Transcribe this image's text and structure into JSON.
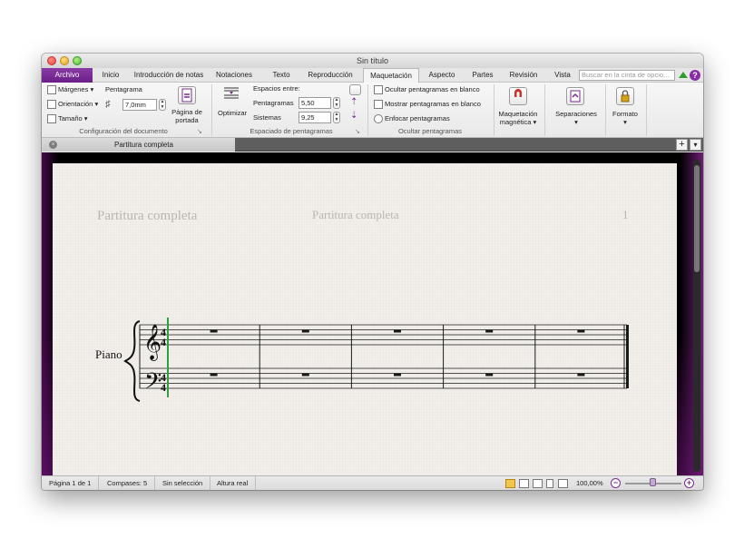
{
  "window": {
    "title": "Sin título"
  },
  "ribbon_tabs": [
    "Archivo",
    "Inicio",
    "Introducción de notas",
    "Notaciones",
    "Texto",
    "Reproducción",
    "Maquetación",
    "Aspecto",
    "Partes",
    "Revisión",
    "Vista"
  ],
  "active_tab": "Maquetación",
  "search": {
    "placeholder": "Buscar en la cinta de opcio..."
  },
  "help": {
    "label": "?"
  },
  "doc_config": {
    "margins": "Márgenes",
    "orientation": "Orientación",
    "size": "Tamaño",
    "staff_label": "Pentagrama",
    "staff_value": "7,0mm",
    "cover_page_line1": "Página de",
    "cover_page_line2": "portada",
    "group_label": "Configuración del documento"
  },
  "staff_spacing": {
    "optimize": "Optimizar",
    "spaces_between": "Espacios entre:",
    "staves_label": "Pentagramas",
    "staves_value": "5,50",
    "systems_label": "Sistemas",
    "systems_value": "9,25",
    "group_label": "Espaciado de pentagramas"
  },
  "hide_staves": {
    "hide_empty": "Ocultar pentagramas en blanco",
    "show_empty": "Mostrar pentagramas en blanco",
    "focus": "Enfocar pentagramas",
    "group_label": "Ocultar pentagramas"
  },
  "magnetic": {
    "line1": "Maquetación",
    "line2": "magnética"
  },
  "breaks": {
    "label": "Separaciones"
  },
  "format": {
    "label": "Formato"
  },
  "document_tab": {
    "title": "Partitura completa",
    "close_glyph": "×"
  },
  "toolbar_extra": {
    "plus": "+",
    "menu": "▾"
  },
  "score": {
    "header_left": "Partitura completa",
    "header_center": "Partitura completa",
    "page_number": "1",
    "instrument": "Piano",
    "time_signature": "4/4",
    "measures": 5,
    "rest_type": "whole",
    "colors": {
      "staff": "#1a1a1a",
      "cursor": "#2ea043"
    }
  },
  "status": {
    "page": "Página 1 de 1",
    "bars": "Compases: 5",
    "selection": "Sin selección",
    "pitch": "Altura real",
    "zoom": "100,00%"
  },
  "colors": {
    "accent": "#6b1f86",
    "canvas_border": "#5a1466",
    "paper": "#f2efea"
  }
}
